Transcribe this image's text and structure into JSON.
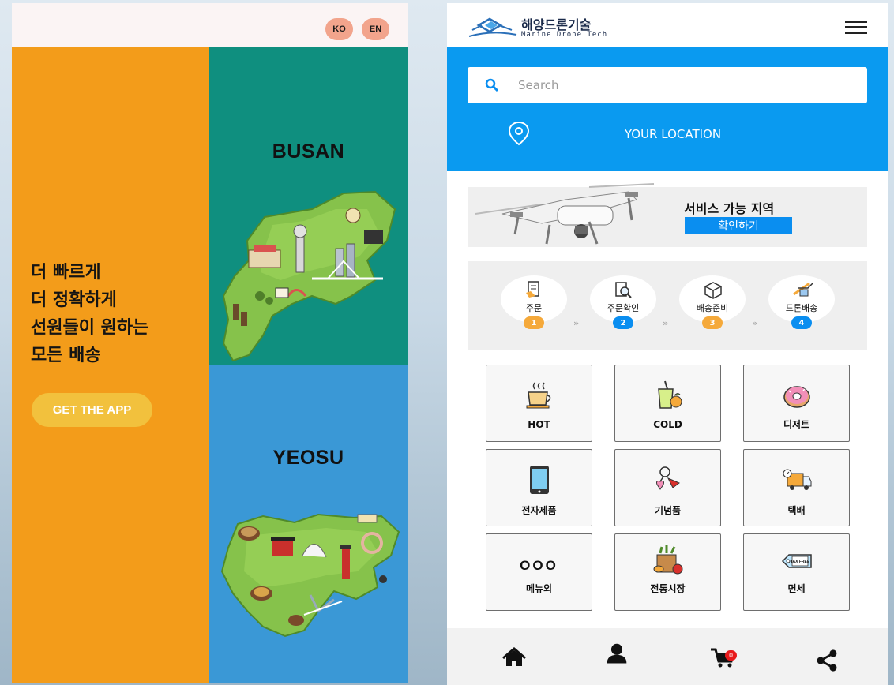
{
  "left_panel": {
    "lang_ko": "KO",
    "lang_en": "EN",
    "slogan_lines": [
      "더 빠르게",
      "더 정확하게",
      "선원들이 원하는",
      "모든 배송"
    ],
    "cta_label": "GET THE APP",
    "city_1": "BUSAN",
    "city_2": "YEOSU",
    "colors": {
      "orange": "#f39c1a",
      "teal": "#0f8f7f",
      "blue": "#3a98d6",
      "lang_btn": "#f2a48c",
      "cta": "#f2c13d"
    }
  },
  "right_panel": {
    "logo_ko": "해양드론기술",
    "logo_en": "Marine Drone Tech",
    "search": {
      "placeholder": "Search"
    },
    "location_label": "YOUR LOCATION",
    "service_banner": {
      "title": "서비스 가능 지역",
      "button": "확인하기"
    },
    "steps": [
      {
        "label": "주문",
        "num": "1",
        "icon": "receipt-icon",
        "color": "#f5a93a"
      },
      {
        "label": "주문확인",
        "num": "2",
        "icon": "magnifier-receipt-icon",
        "color": "#0a8ef0"
      },
      {
        "label": "배송준비",
        "num": "3",
        "icon": "box-icon",
        "color": "#f5a93a"
      },
      {
        "label": "드론배송",
        "num": "4",
        "icon": "drone-delivery-icon",
        "color": "#0a8ef0"
      }
    ],
    "step_separator": "»",
    "categories": [
      {
        "label": "HOT",
        "icon": "hot-coffee-icon"
      },
      {
        "label": "COLD",
        "icon": "cold-drink-icon"
      },
      {
        "label": "디저트",
        "icon": "donut-icon"
      },
      {
        "label": "전자제품",
        "icon": "tablet-icon"
      },
      {
        "label": "기념품",
        "icon": "keychain-icon"
      },
      {
        "label": "택배",
        "icon": "delivery-truck-icon"
      },
      {
        "label": "메뉴외",
        "icon": "more-icon"
      },
      {
        "label": "전통시장",
        "icon": "grocery-bag-icon"
      },
      {
        "label": "면세",
        "icon": "tax-free-icon"
      }
    ],
    "more_glyph": "OOO",
    "tax_free_tag": "TAX FREE",
    "bottom_nav": {
      "cart_count": "0"
    },
    "colors": {
      "brand_blue": "#0a9af0",
      "button_blue": "#0a8ef0",
      "badge_red": "#e8191b"
    }
  }
}
